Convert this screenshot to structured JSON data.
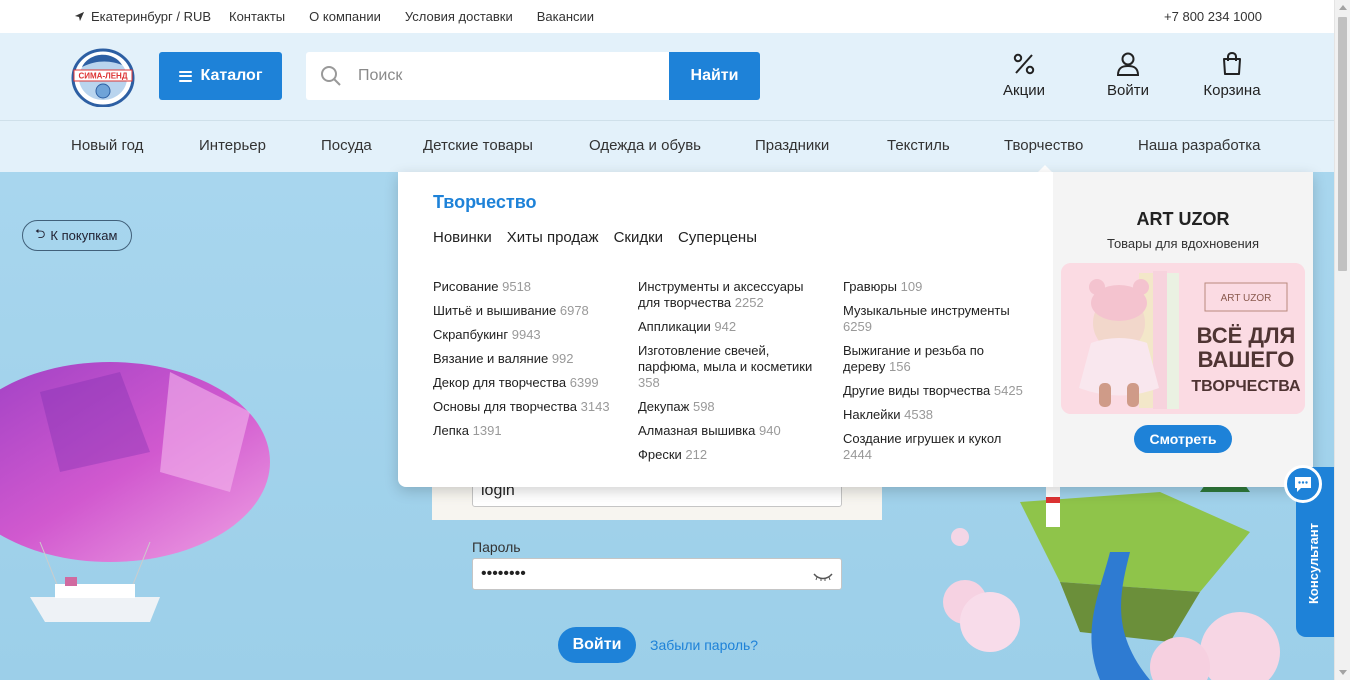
{
  "topbar": {
    "location": "Екатеринбург / RUB",
    "links": [
      "Контакты",
      "О компании",
      "Условия доставки",
      "Вакансии"
    ],
    "phone": "+7 800 234 1000"
  },
  "header": {
    "logo_text": "СИМА-ЛЕНД",
    "catalog_label": "Каталог",
    "search_placeholder": "Поиск",
    "find_label": "Найти",
    "actions": [
      {
        "label": "Акции",
        "icon": "percent-icon"
      },
      {
        "label": "Войти",
        "icon": "user-icon"
      },
      {
        "label": "Корзина",
        "icon": "bag-icon"
      }
    ]
  },
  "categories": [
    "Новый год",
    "Интерьер",
    "Посуда",
    "Детские товары",
    "Одежда и обувь",
    "Праздники",
    "Текстиль",
    "Творчество",
    "Наша разработка"
  ],
  "back_label": "К покупкам",
  "login": {
    "login_value": "login",
    "password_label": "Пароль",
    "password_value": "••••••••",
    "submit_label": "Войти",
    "forgot_label": "Забыли пароль?"
  },
  "dropdown": {
    "title": "Творчество",
    "quick_links": [
      "Новинки",
      "Хиты продаж",
      "Скидки",
      "Суперцены"
    ],
    "columns": [
      [
        {
          "label": "Рисование",
          "count": "9518"
        },
        {
          "label": "Шитьё и вышивание",
          "count": "6978"
        },
        {
          "label": "Скрапбукинг",
          "count": "9943"
        },
        {
          "label": "Вязание и валяние",
          "count": "992"
        },
        {
          "label": "Декор для творчества",
          "count": "6399"
        },
        {
          "label": "Основы для творчества",
          "count": "3143"
        },
        {
          "label": "Лепка",
          "count": "1391"
        }
      ],
      [
        {
          "label": "Инструменты и аксессуары для творчества",
          "count": "2252"
        },
        {
          "label": "Аппликации",
          "count": "942"
        },
        {
          "label": "Изготовление свечей, парфюма, мыла и косметики",
          "count": "358"
        },
        {
          "label": "Декупаж",
          "count": "598"
        },
        {
          "label": "Алмазная вышивка",
          "count": "940"
        },
        {
          "label": "Фрески",
          "count": "212"
        }
      ],
      [
        {
          "label": "Гравюры",
          "count": "109"
        },
        {
          "label": "Музыкальные инструменты",
          "count": "6259"
        },
        {
          "label": "Выжигание и резьба по дереву",
          "count": "156"
        },
        {
          "label": "Другие виды творчества",
          "count": "5425"
        },
        {
          "label": "Наклейки",
          "count": "4538"
        },
        {
          "label": "Создание игрушек и кукол",
          "count": "2444"
        }
      ]
    ],
    "promo": {
      "title": "ART UZOR",
      "subtitle": "Товары для вдохновения",
      "image_badge": "ART UZOR",
      "image_slogan": [
        "ВСЁ ДЛЯ",
        "ВАШЕГО",
        "ТВОРЧЕСТВА"
      ],
      "button_label": "Смотреть"
    }
  },
  "consultant_label": "Консультант",
  "colors": {
    "accent": "#1e82d8",
    "header_bg": "#e3f1fa",
    "page_bg": "#a8d3ec"
  }
}
